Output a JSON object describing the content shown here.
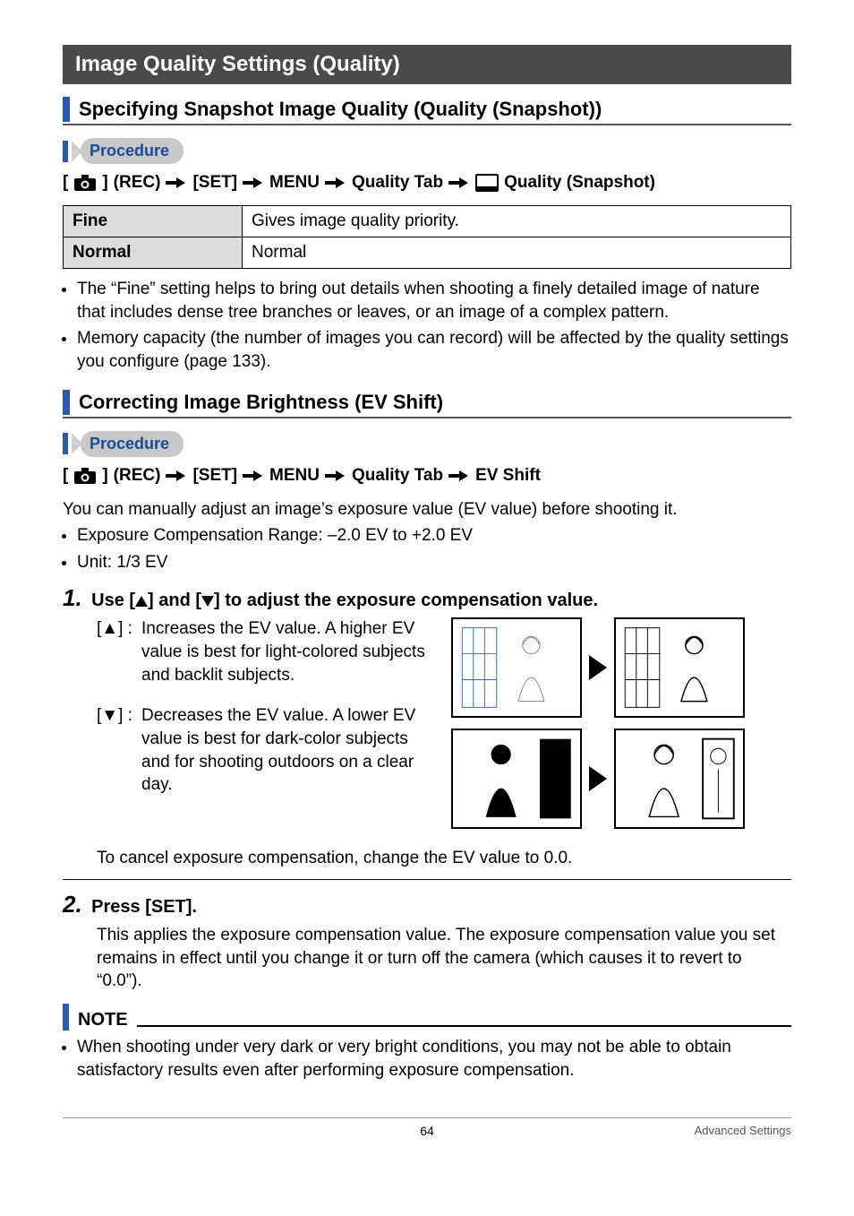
{
  "section_header": "Image Quality Settings (Quality)",
  "sub1": {
    "title": "Specifying Snapshot Image Quality (Quality (Snapshot))",
    "procedure_label": "Procedure",
    "crumb": {
      "rec": "(REC)",
      "set": "[SET]",
      "menu": "MENU",
      "qtab": "Quality Tab",
      "qsnap": "Quality (Snapshot)"
    },
    "table": {
      "fine_label": "Fine",
      "fine_desc": "Gives image quality priority.",
      "normal_label": "Normal",
      "normal_desc": "Normal"
    },
    "bullets": [
      "The “Fine” setting helps to bring out details when shooting a finely detailed image of nature that includes dense tree branches or leaves, or an image of a complex pattern.",
      "Memory capacity (the number of images you can record) will be affected by the quality settings you configure (page 133)."
    ]
  },
  "sub2": {
    "title": "Correcting Image Brightness (EV Shift)",
    "procedure_label": "Procedure",
    "crumb": {
      "rec": "(REC)",
      "set": "[SET]",
      "menu": "MENU",
      "qtab": "Quality Tab",
      "evshift": "EV Shift"
    },
    "intro": "You can manually adjust an image’s exposure value (EV value) before shooting it.",
    "intro_bullets": [
      "Exposure Compensation Range: –2.0 EV to +2.0 EV",
      "Unit: 1/3 EV"
    ],
    "step1": {
      "num": "1.",
      "title_pre": "Use [",
      "title_mid": "] and [",
      "title_post": "] to adjust the exposure compensation value.",
      "up_key": "[▲] :",
      "up_desc": "Increases the EV value. A higher EV value is best for light-colored subjects and backlit subjects.",
      "down_key": "[▼] :",
      "down_desc": "Decreases the EV value. A lower EV value is best for dark-color subjects and for shooting outdoors on a clear day.",
      "cancel": "To cancel exposure compensation, change the EV value to 0.0."
    },
    "step2": {
      "num": "2.",
      "title": "Press [SET].",
      "body": "This applies the exposure compensation value. The exposure compensation value you set remains in effect until you change it or turn off the camera (which causes it to revert to “0.0”)."
    },
    "note_label": "NOTE",
    "note_body": "When shooting under very dark or very bright conditions, you may not be able to obtain satisfactory results even after performing exposure compensation."
  },
  "chart_data": {
    "type": "table",
    "title": "Snapshot Quality Options",
    "rows": [
      {
        "option": "Fine",
        "description": "Gives image quality priority."
      },
      {
        "option": "Normal",
        "description": "Normal"
      }
    ]
  },
  "footer": {
    "page": "64",
    "section": "Advanced Settings"
  }
}
